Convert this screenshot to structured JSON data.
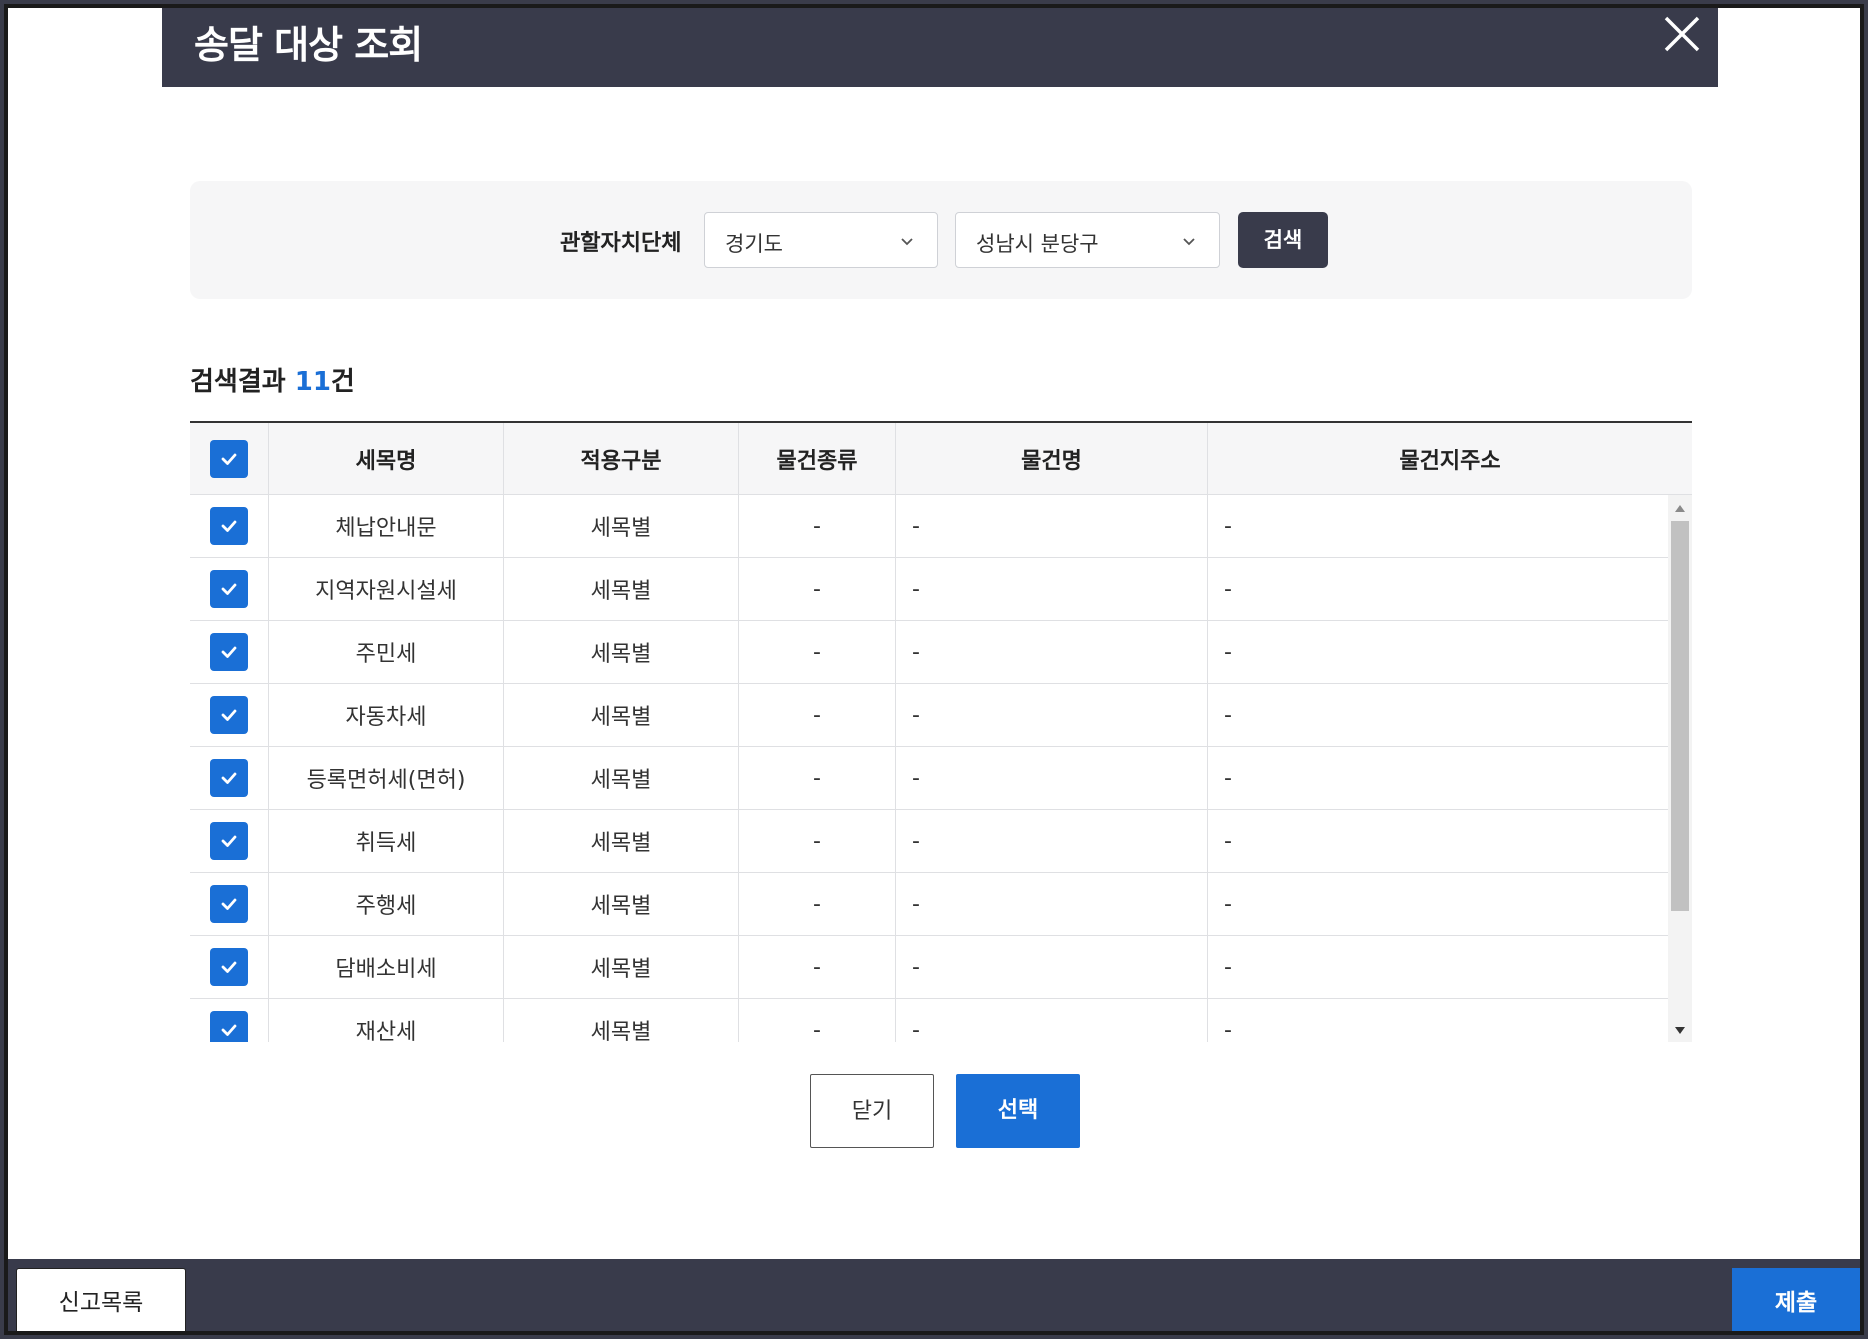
{
  "modal": {
    "title": "송달 대상 조회"
  },
  "search": {
    "label": "관할자치단체",
    "province": "경기도",
    "district": "성남시 분당구",
    "button": "검색"
  },
  "result": {
    "prefix": "검색결과 ",
    "count": "11",
    "suffix": "건"
  },
  "table": {
    "headers": [
      "세목명",
      "적용구분",
      "물건종류",
      "물건명",
      "물건지주소"
    ],
    "rows": [
      {
        "name": "체납안내문",
        "type": "세목별",
        "kind": "-",
        "item": "-",
        "address": "-"
      },
      {
        "name": "지역자원시설세",
        "type": "세목별",
        "kind": "-",
        "item": "-",
        "address": "-"
      },
      {
        "name": "주민세",
        "type": "세목별",
        "kind": "-",
        "item": "-",
        "address": "-"
      },
      {
        "name": "자동차세",
        "type": "세목별",
        "kind": "-",
        "item": "-",
        "address": "-"
      },
      {
        "name": "등록면허세(면허)",
        "type": "세목별",
        "kind": "-",
        "item": "-",
        "address": "-"
      },
      {
        "name": "취득세",
        "type": "세목별",
        "kind": "-",
        "item": "-",
        "address": "-"
      },
      {
        "name": "주행세",
        "type": "세목별",
        "kind": "-",
        "item": "-",
        "address": "-"
      },
      {
        "name": "담배소비세",
        "type": "세목별",
        "kind": "-",
        "item": "-",
        "address": "-"
      },
      {
        "name": "재산세",
        "type": "세목별",
        "kind": "-",
        "item": "-",
        "address": "-"
      }
    ]
  },
  "actions": {
    "close": "닫기",
    "select": "선택"
  },
  "footer": {
    "left": "신고목록",
    "right": "제출"
  },
  "colors": {
    "accent": "#1a6fd6",
    "header_bg": "#393b4b"
  }
}
